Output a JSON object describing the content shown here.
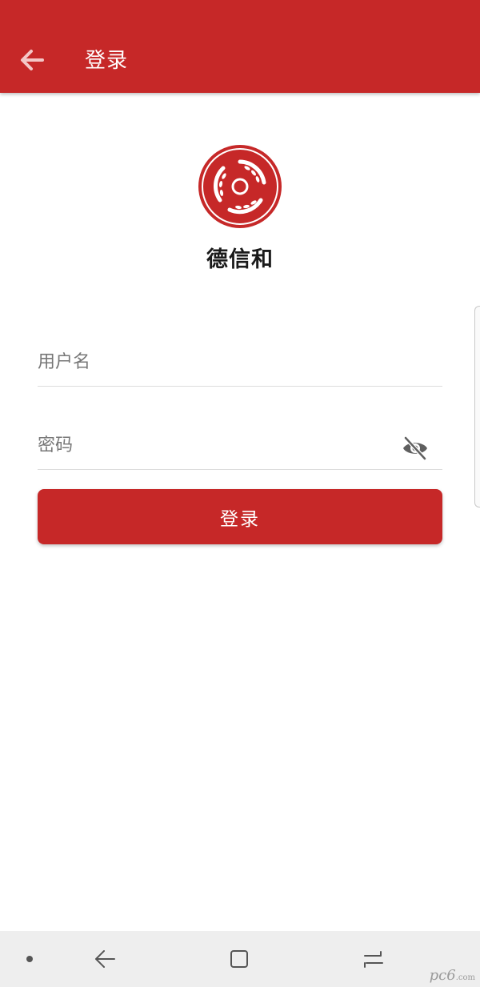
{
  "appbar": {
    "title": "登录",
    "back_icon": "arrow-left-icon",
    "background": "#c62828"
  },
  "brand": {
    "name": "德信和",
    "logo_icon": "wheat-circle-logo"
  },
  "form": {
    "username_placeholder": "用户名",
    "password_placeholder": "密码",
    "password_toggle_icon": "eye-off-icon",
    "submit_label": "登录"
  },
  "system_nav": {
    "items": [
      "dot-icon",
      "back-icon",
      "recents-icon",
      "home-icon"
    ]
  },
  "watermark": {
    "text": "pc6",
    "sub": ".com"
  }
}
